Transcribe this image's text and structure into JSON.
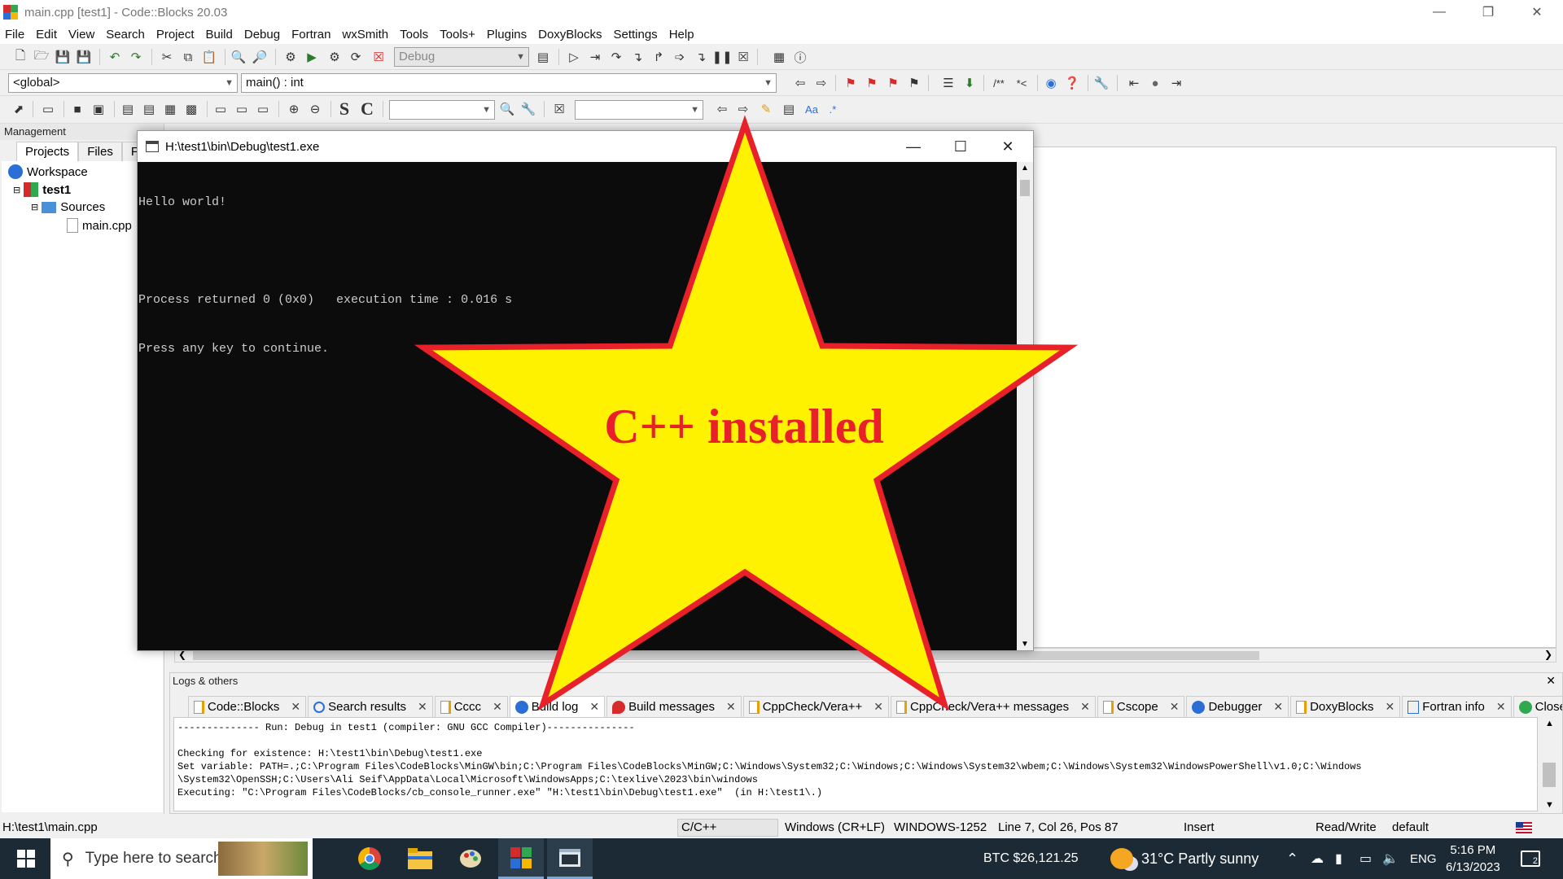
{
  "window": {
    "title": "main.cpp [test1] - Code::Blocks 20.03",
    "controls": {
      "minimize": "—",
      "maximize": "❐",
      "close": "✕"
    }
  },
  "menu": [
    "File",
    "Edit",
    "View",
    "Search",
    "Project",
    "Build",
    "Debug",
    "Fortran",
    "wxSmith",
    "Tools",
    "Tools+",
    "Plugins",
    "DoxyBlocks",
    "Settings",
    "Help"
  ],
  "toolbar": {
    "build_target": "Debug",
    "scope": "<global>",
    "function": "main() : int"
  },
  "management": {
    "header": "Management",
    "tabs": [
      "Projects",
      "Files",
      "FS"
    ],
    "tree": {
      "workspace": "Workspace",
      "project": "test1",
      "folder": "Sources",
      "file": "main.cpp"
    }
  },
  "console": {
    "title": "H:\\test1\\bin\\Debug\\test1.exe",
    "lines": [
      "Hello world!",
      "",
      "Process returned 0 (0x0)   execution time : 0.016 s",
      "Press any key to continue."
    ]
  },
  "overlay": {
    "text": "C++ installed",
    "fill_color": "#fff200",
    "stroke_color": "#e8202a",
    "text_color": "#e8202a"
  },
  "logs": {
    "header": "Logs & others",
    "tabs": [
      {
        "label": "Code::Blocks",
        "icon": "page-icon"
      },
      {
        "label": "Search results",
        "icon": "search-icon"
      },
      {
        "label": "Cccc",
        "icon": "page-icon"
      },
      {
        "label": "Build log",
        "icon": "gear-icon",
        "active": true
      },
      {
        "label": "Build messages",
        "icon": "pin-icon"
      },
      {
        "label": "CppCheck/Vera++",
        "icon": "page-icon"
      },
      {
        "label": "CppCheck/Vera++ messages",
        "icon": "page-icon"
      },
      {
        "label": "Cscope",
        "icon": "page-icon"
      },
      {
        "label": "Debugger",
        "icon": "gear-icon"
      },
      {
        "label": "DoxyBlocks",
        "icon": "page-icon"
      },
      {
        "label": "Fortran info",
        "icon": "f-icon"
      },
      {
        "label": "Close",
        "icon": "close-icon"
      }
    ],
    "lines": [
      "-------------- Run: Debug in test1 (compiler: GNU GCC Compiler)---------------",
      "",
      "Checking for existence: H:\\test1\\bin\\Debug\\test1.exe",
      "Set variable: PATH=.;C:\\Program Files\\CodeBlocks\\MinGW\\bin;C:\\Program Files\\CodeBlocks\\MinGW;C:\\Windows\\System32;C:\\Windows;C:\\Windows\\System32\\wbem;C:\\Windows\\System32\\WindowsPowerShell\\v1.0;C:\\Windows",
      "\\System32\\OpenSSH;C:\\Users\\Ali Seif\\AppData\\Local\\Microsoft\\WindowsApps;C:\\texlive\\2023\\bin\\windows",
      "Executing: \"C:\\Program Files\\CodeBlocks/cb_console_runner.exe\" \"H:\\test1\\bin\\Debug\\test1.exe\"  (in H:\\test1\\.)"
    ]
  },
  "statusbar": {
    "file": "H:\\test1\\main.cpp",
    "language": "C/C++",
    "line_endings": "Windows (CR+LF)",
    "encoding": "WINDOWS-1252",
    "position": "Line 7, Col 26, Pos 87",
    "mode": "Insert",
    "access": "Read/Write",
    "profile": "default"
  },
  "taskbar": {
    "search_placeholder": "Type here to search",
    "btc": "BTC $26,121.25",
    "weather": "31°C  Partly sunny",
    "lang": "ENG",
    "time": "5:16 PM",
    "date": "6/13/2023",
    "notifications": "2"
  }
}
